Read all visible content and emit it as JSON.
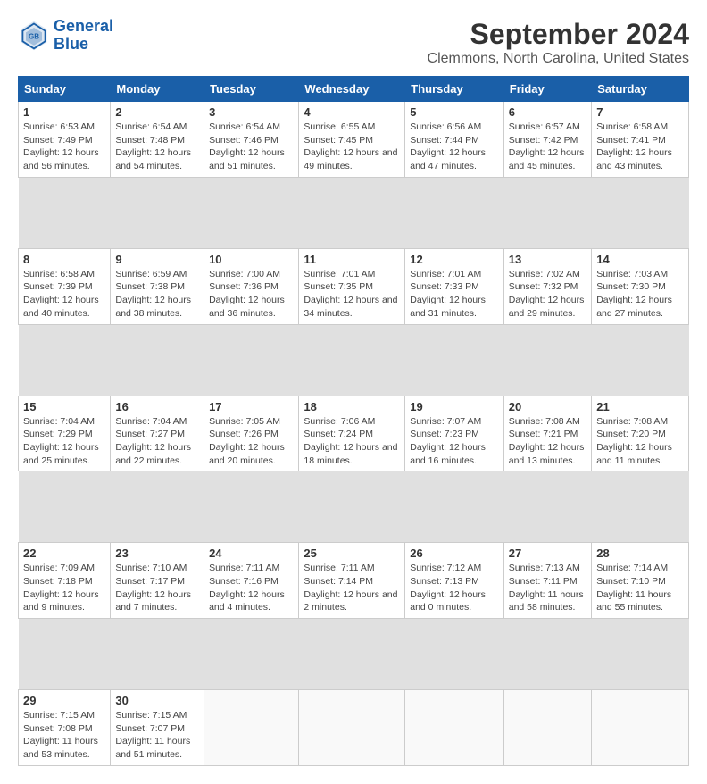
{
  "header": {
    "logo_line1": "General",
    "logo_line2": "Blue",
    "title": "September 2024",
    "subtitle": "Clemmons, North Carolina, United States"
  },
  "columns": [
    "Sunday",
    "Monday",
    "Tuesday",
    "Wednesday",
    "Thursday",
    "Friday",
    "Saturday"
  ],
  "weeks": [
    {
      "days": [
        {
          "num": "1",
          "rise": "6:53 AM",
          "set": "7:49 PM",
          "daylight": "12 hours and 56 minutes."
        },
        {
          "num": "2",
          "rise": "6:54 AM",
          "set": "7:48 PM",
          "daylight": "12 hours and 54 minutes."
        },
        {
          "num": "3",
          "rise": "6:54 AM",
          "set": "7:46 PM",
          "daylight": "12 hours and 51 minutes."
        },
        {
          "num": "4",
          "rise": "6:55 AM",
          "set": "7:45 PM",
          "daylight": "12 hours and 49 minutes."
        },
        {
          "num": "5",
          "rise": "6:56 AM",
          "set": "7:44 PM",
          "daylight": "12 hours and 47 minutes."
        },
        {
          "num": "6",
          "rise": "6:57 AM",
          "set": "7:42 PM",
          "daylight": "12 hours and 45 minutes."
        },
        {
          "num": "7",
          "rise": "6:58 AM",
          "set": "7:41 PM",
          "daylight": "12 hours and 43 minutes."
        }
      ]
    },
    {
      "days": [
        {
          "num": "8",
          "rise": "6:58 AM",
          "set": "7:39 PM",
          "daylight": "12 hours and 40 minutes."
        },
        {
          "num": "9",
          "rise": "6:59 AM",
          "set": "7:38 PM",
          "daylight": "12 hours and 38 minutes."
        },
        {
          "num": "10",
          "rise": "7:00 AM",
          "set": "7:36 PM",
          "daylight": "12 hours and 36 minutes."
        },
        {
          "num": "11",
          "rise": "7:01 AM",
          "set": "7:35 PM",
          "daylight": "12 hours and 34 minutes."
        },
        {
          "num": "12",
          "rise": "7:01 AM",
          "set": "7:33 PM",
          "daylight": "12 hours and 31 minutes."
        },
        {
          "num": "13",
          "rise": "7:02 AM",
          "set": "7:32 PM",
          "daylight": "12 hours and 29 minutes."
        },
        {
          "num": "14",
          "rise": "7:03 AM",
          "set": "7:30 PM",
          "daylight": "12 hours and 27 minutes."
        }
      ]
    },
    {
      "days": [
        {
          "num": "15",
          "rise": "7:04 AM",
          "set": "7:29 PM",
          "daylight": "12 hours and 25 minutes."
        },
        {
          "num": "16",
          "rise": "7:04 AM",
          "set": "7:27 PM",
          "daylight": "12 hours and 22 minutes."
        },
        {
          "num": "17",
          "rise": "7:05 AM",
          "set": "7:26 PM",
          "daylight": "12 hours and 20 minutes."
        },
        {
          "num": "18",
          "rise": "7:06 AM",
          "set": "7:24 PM",
          "daylight": "12 hours and 18 minutes."
        },
        {
          "num": "19",
          "rise": "7:07 AM",
          "set": "7:23 PM",
          "daylight": "12 hours and 16 minutes."
        },
        {
          "num": "20",
          "rise": "7:08 AM",
          "set": "7:21 PM",
          "daylight": "12 hours and 13 minutes."
        },
        {
          "num": "21",
          "rise": "7:08 AM",
          "set": "7:20 PM",
          "daylight": "12 hours and 11 minutes."
        }
      ]
    },
    {
      "days": [
        {
          "num": "22",
          "rise": "7:09 AM",
          "set": "7:18 PM",
          "daylight": "12 hours and 9 minutes."
        },
        {
          "num": "23",
          "rise": "7:10 AM",
          "set": "7:17 PM",
          "daylight": "12 hours and 7 minutes."
        },
        {
          "num": "24",
          "rise": "7:11 AM",
          "set": "7:16 PM",
          "daylight": "12 hours and 4 minutes."
        },
        {
          "num": "25",
          "rise": "7:11 AM",
          "set": "7:14 PM",
          "daylight": "12 hours and 2 minutes."
        },
        {
          "num": "26",
          "rise": "7:12 AM",
          "set": "7:13 PM",
          "daylight": "12 hours and 0 minutes."
        },
        {
          "num": "27",
          "rise": "7:13 AM",
          "set": "7:11 PM",
          "daylight": "11 hours and 58 minutes."
        },
        {
          "num": "28",
          "rise": "7:14 AM",
          "set": "7:10 PM",
          "daylight": "11 hours and 55 minutes."
        }
      ]
    },
    {
      "days": [
        {
          "num": "29",
          "rise": "7:15 AM",
          "set": "7:08 PM",
          "daylight": "11 hours and 53 minutes."
        },
        {
          "num": "30",
          "rise": "7:15 AM",
          "set": "7:07 PM",
          "daylight": "11 hours and 51 minutes."
        },
        null,
        null,
        null,
        null,
        null
      ]
    }
  ]
}
